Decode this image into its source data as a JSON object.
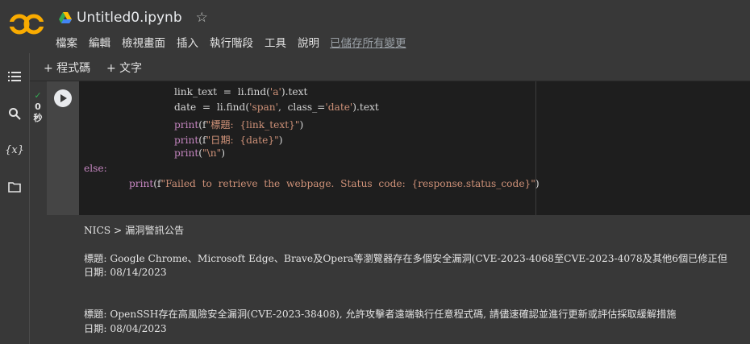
{
  "header": {
    "logo_text": "CO",
    "title": "Untitled0.ipynb",
    "star_icon": "☆",
    "menu": [
      "檔案",
      "編輯",
      "檢視畫面",
      "插入",
      "執行階段",
      "工具",
      "說明"
    ],
    "saved_status": "已儲存所有變更"
  },
  "toolbar": {
    "add_code": "+ 程式碼",
    "add_text": "+ 文字"
  },
  "cell": {
    "exec_check": "✓",
    "exec_time": "0",
    "exec_unit": "秒",
    "code_lines": {
      "l1a": "link_text  =  li.find(",
      "l1b": "'a'",
      "l1c": ").text",
      "l2a": "date  =  li.find(",
      "l2b": "'span'",
      "l2c": ",  class_=",
      "l2d": "'date'",
      "l2e": ").text",
      "l3a": "print",
      "l3b": "(f",
      "l3c": "\"標題:  {link_text}\"",
      "l3d": ")",
      "l4a": "print",
      "l4b": "(f",
      "l4c": "\"日期:  {date}\"",
      "l4d": ")",
      "l5a": "print",
      "l5b": "(",
      "l5c": "\"\\n\"",
      "l5d": ")",
      "l6": "else:",
      "l7a": "print",
      "l7b": "(f",
      "l7c": "\"Failed  to  retrieve  the  webpage.  Status  code:  {response.status_code}\"",
      "l7d": ")"
    }
  },
  "output": {
    "line1": "NICS > 漏洞警訊公告",
    "line2": "標題: Google Chrome、Microsoft Edge、Brave及Opera等瀏覽器存在多個安全漏洞(CVE-2023-4068至CVE-2023-4078及其他6個已修正但",
    "line3": "日期: 08/14/2023",
    "line4": "標題: OpenSSH存在高風險安全漏洞(CVE-2023-38408), 允許攻擊者遠端執行任意程式碼, 請儘速確認並進行更新或評估採取緩解措施",
    "line5": "日期: 08/04/2023"
  },
  "colors": {
    "logo_orange": "#f9ab00",
    "check_green": "#34a853"
  },
  "icons": [
    "menu-list-icon",
    "search-icon",
    "variables-icon",
    "folder-icon",
    "drive-icon",
    "star-icon",
    "run-icon"
  ]
}
